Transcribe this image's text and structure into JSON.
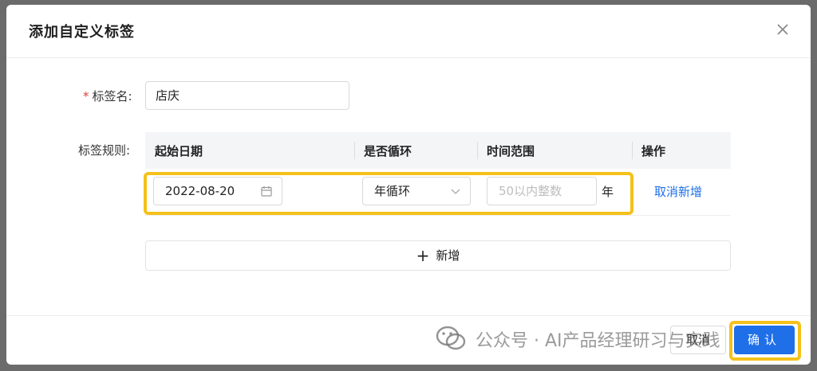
{
  "dialog": {
    "title": "添加自定义标签",
    "close_icon": "close-icon"
  },
  "form": {
    "name_label": "标签名:",
    "name_value": "店庆",
    "rules_label": "标签规则:"
  },
  "table": {
    "headers": [
      "起始日期",
      "是否循环",
      "时间范围",
      "操作"
    ],
    "row": {
      "date": "2022-08-20",
      "date_icon": "calendar-icon",
      "cycle": "年循环",
      "cycle_icon": "chevron-down-icon",
      "range_placeholder": "50以内整数",
      "unit": "年",
      "action": "取消新增"
    }
  },
  "add_button": {
    "label": "新增",
    "icon": "plus-icon"
  },
  "footer": {
    "cancel": "取消",
    "ok": "确认"
  },
  "watermark": {
    "text": "公众号 · AI产品经理研习与实践"
  },
  "colors": {
    "primary": "#1f6fe8",
    "highlight": "#f5c11a",
    "required": "#e03b3b"
  }
}
